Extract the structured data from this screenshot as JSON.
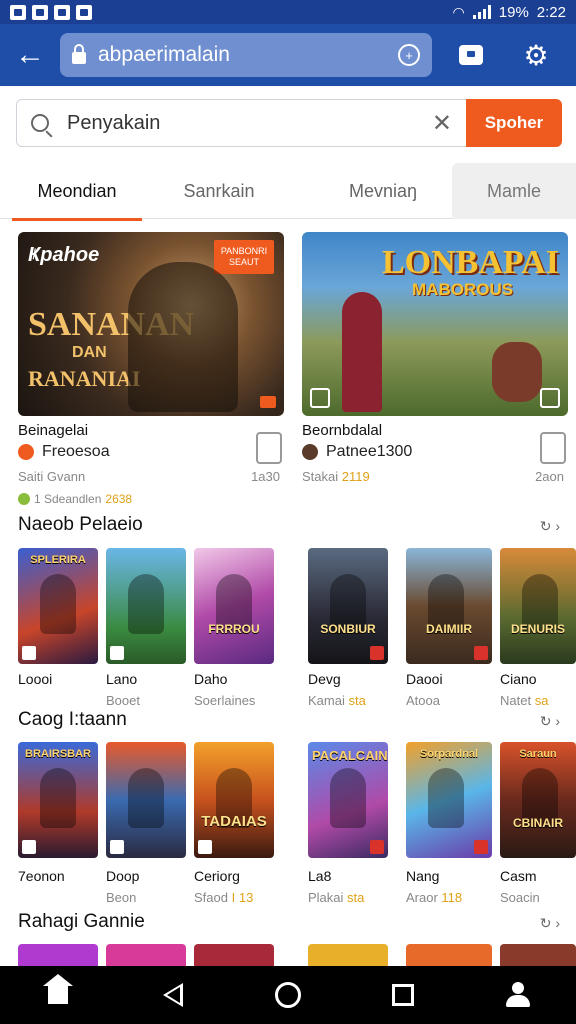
{
  "status_bar": {
    "battery": "19%",
    "time": "2:22"
  },
  "browser": {
    "url": "abpaerimalain"
  },
  "search": {
    "value": "Penyakain",
    "button_label": "Spoher"
  },
  "tabs": [
    {
      "label": "Meondian"
    },
    {
      "label": "Sanrkain"
    },
    {
      "label": "Mevniaŋ"
    },
    {
      "label": "Mamle"
    }
  ],
  "featured": [
    {
      "banner_logo": "Ҝpahoe",
      "banner_title": "SANANAN",
      "banner_sub": "DAN",
      "banner_tag": "RANANIAI",
      "badge": "PANBONRI SEAUT",
      "title": "Beinagelai",
      "developer": "Freoesoa",
      "meta_left": "Saiti Gvann",
      "meta_right": "1a30",
      "dl_count": "1 Sdeandlen",
      "dl_rating": "2638"
    },
    {
      "banner_title": "LONBAPAI",
      "banner_sub": "MABOROUS",
      "title": "Beornbdalal",
      "developer": "Patnee1300",
      "meta_left": "Stakai",
      "meta_rating": "2119",
      "meta_right": "2aon"
    }
  ],
  "sections": [
    {
      "title": "Naeob Pelaeio",
      "more": "↻ ›",
      "items": [
        {
          "art_top": "SPLERIRA",
          "art": "",
          "name": "Loooi",
          "sub": ""
        },
        {
          "art_top": "",
          "art": "",
          "name": "Lano",
          "sub": "Booet"
        },
        {
          "art_top": "",
          "art": "FRRROU",
          "name": "Daho",
          "sub": "Soerlaines"
        },
        {
          "art_top": "",
          "art": "SONBIUR",
          "name": "Devg",
          "sub": "Kamai",
          "rating": "sta"
        },
        {
          "art_top": "",
          "art": "DAIMIIR",
          "name": "Daooi",
          "sub": "Atooa"
        },
        {
          "art_top": "",
          "art": "DENURIS",
          "name": "Ciano",
          "sub": "Natet",
          "rating": "sa"
        }
      ]
    },
    {
      "title": "Caog I:taann",
      "more": "↻ ›",
      "items": [
        {
          "art_top": "BRAIRSBAR",
          "art": "",
          "name": "7eonon",
          "sub": ""
        },
        {
          "art_top": "",
          "art": "",
          "name": "Doop",
          "sub": "Beon"
        },
        {
          "art_top": "",
          "art": "TADAIAS",
          "name": "Ceriorg",
          "sub": "Sfaod",
          "rating": "I 13"
        },
        {
          "art_top": "PACALCAIN",
          "art": "",
          "name": "La8",
          "sub": "Plakai",
          "rating": "sta"
        },
        {
          "art_top": "Sorpardnal",
          "art": "",
          "name": "Nang",
          "sub": "Araor",
          "rating": "118"
        },
        {
          "art_top": "Saraun",
          "art": "CBINAIR",
          "name": "Casm",
          "sub": "Soacin"
        }
      ]
    },
    {
      "title": "Rahagi Gannie",
      "more": "↻ ›"
    }
  ],
  "colors": {
    "status_bar": "#1b3f93",
    "app_bar": "#1f4ea8",
    "accent": "#ef5a1e",
    "rating": "#e0a21a"
  },
  "icons": [
    "back-arrow-icon",
    "lock-icon",
    "compass-icon",
    "tabs-icon",
    "menu-icon",
    "search-icon",
    "clear-icon",
    "home-icon",
    "back-nav-icon",
    "home-circle-icon",
    "recents-icon",
    "account-icon"
  ]
}
